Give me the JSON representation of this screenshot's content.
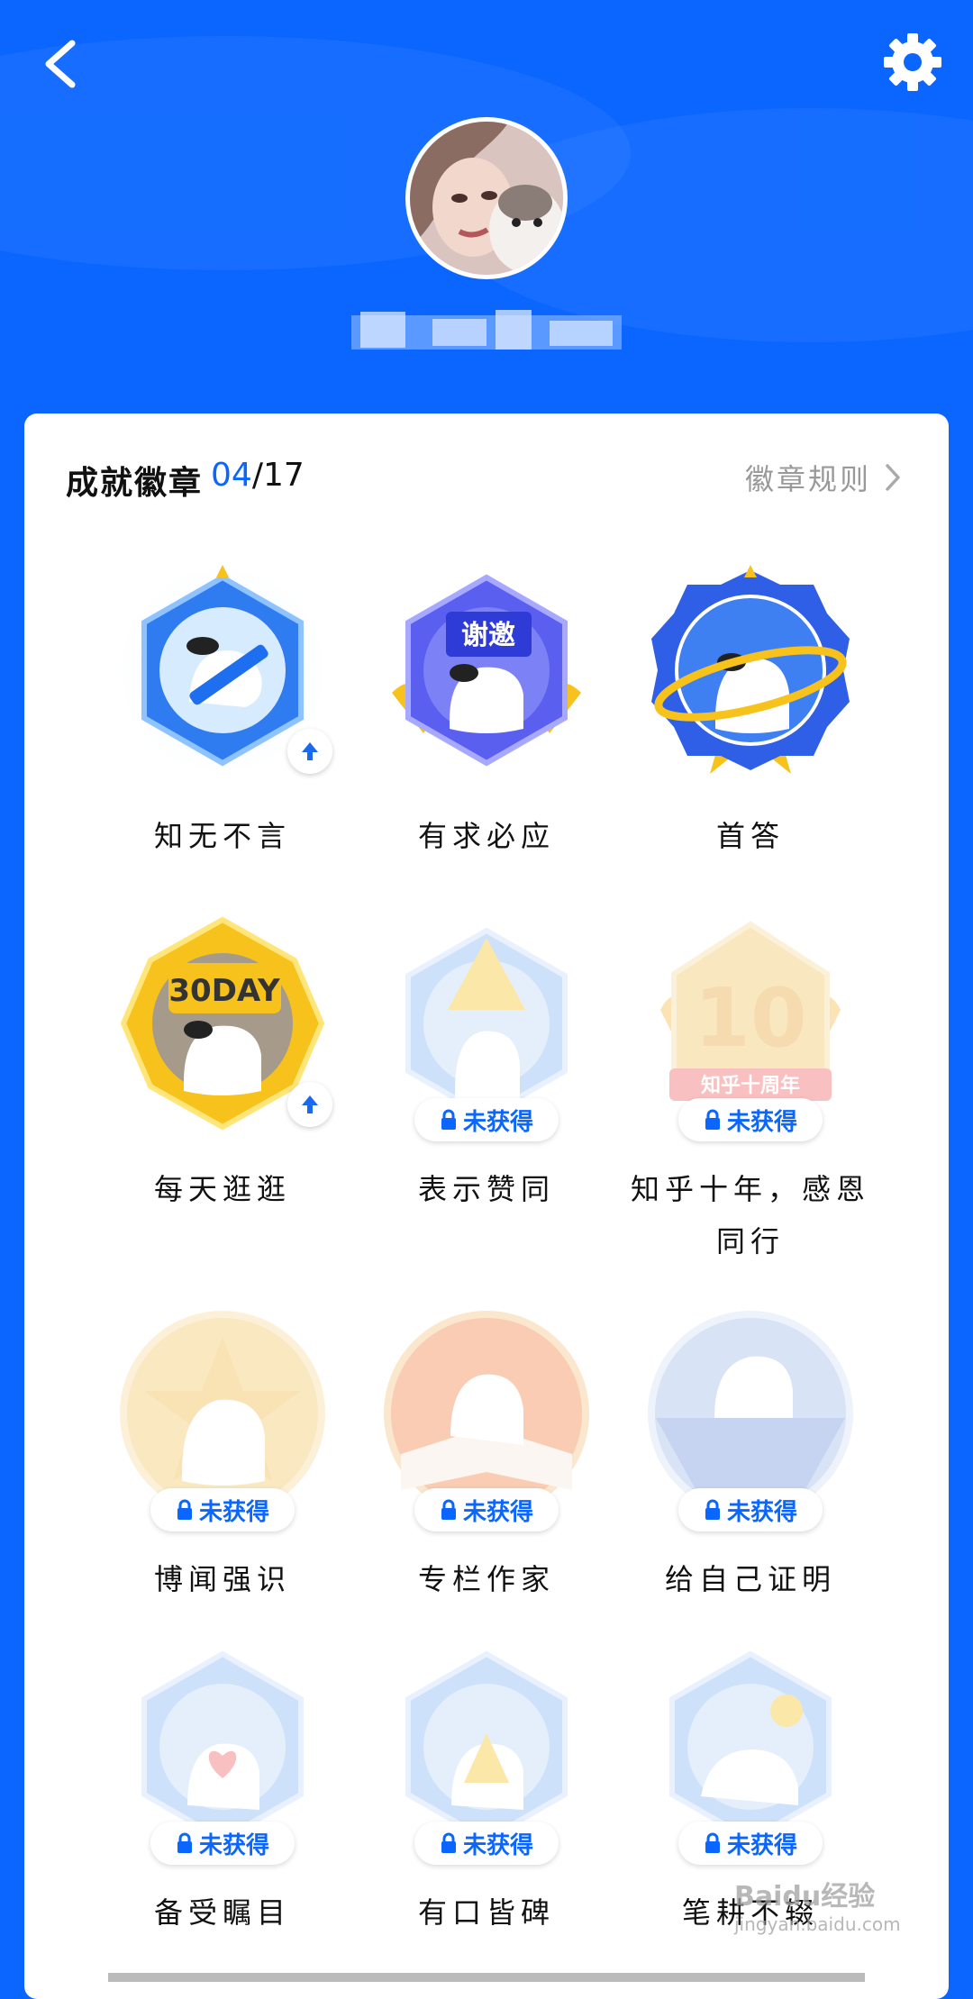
{
  "header": {
    "back_icon": "chevron-left-icon",
    "settings_icon": "gear-icon"
  },
  "profile": {
    "avatar": "user-avatar-photo",
    "username": ""
  },
  "achievements": {
    "title": "成就徽章",
    "earned": "04",
    "total": "/17",
    "rules_label": "徽章规则",
    "locked_label": "未获得",
    "badges": [
      {
        "label": "知无不言",
        "status": "earned",
        "upgradable": true
      },
      {
        "label": "有求必应",
        "status": "earned",
        "upgradable": false,
        "sign": "谢邀"
      },
      {
        "label": "首答",
        "status": "earned",
        "upgradable": false
      },
      {
        "label": "每天逛逛",
        "status": "earned",
        "upgradable": true,
        "sign": "30DAY"
      },
      {
        "label": "表示赞同",
        "status": "locked"
      },
      {
        "label": "知乎十年，感恩同行",
        "status": "locked",
        "sign": "知乎十周年"
      },
      {
        "label": "博闻强识",
        "status": "locked"
      },
      {
        "label": "专栏作家",
        "status": "locked"
      },
      {
        "label": "给自己证明",
        "status": "locked"
      },
      {
        "label": "备受瞩目",
        "status": "locked"
      },
      {
        "label": "有口皆碑",
        "status": "locked"
      },
      {
        "label": "笔耕不辍",
        "status": "locked"
      }
    ]
  },
  "watermark": {
    "line1": "Baidu经验",
    "line2": "jingyan.baidu.com"
  },
  "colors": {
    "brand_blue": "#0a66ff",
    "gold": "#f6c21b",
    "card": "#ffffff"
  }
}
